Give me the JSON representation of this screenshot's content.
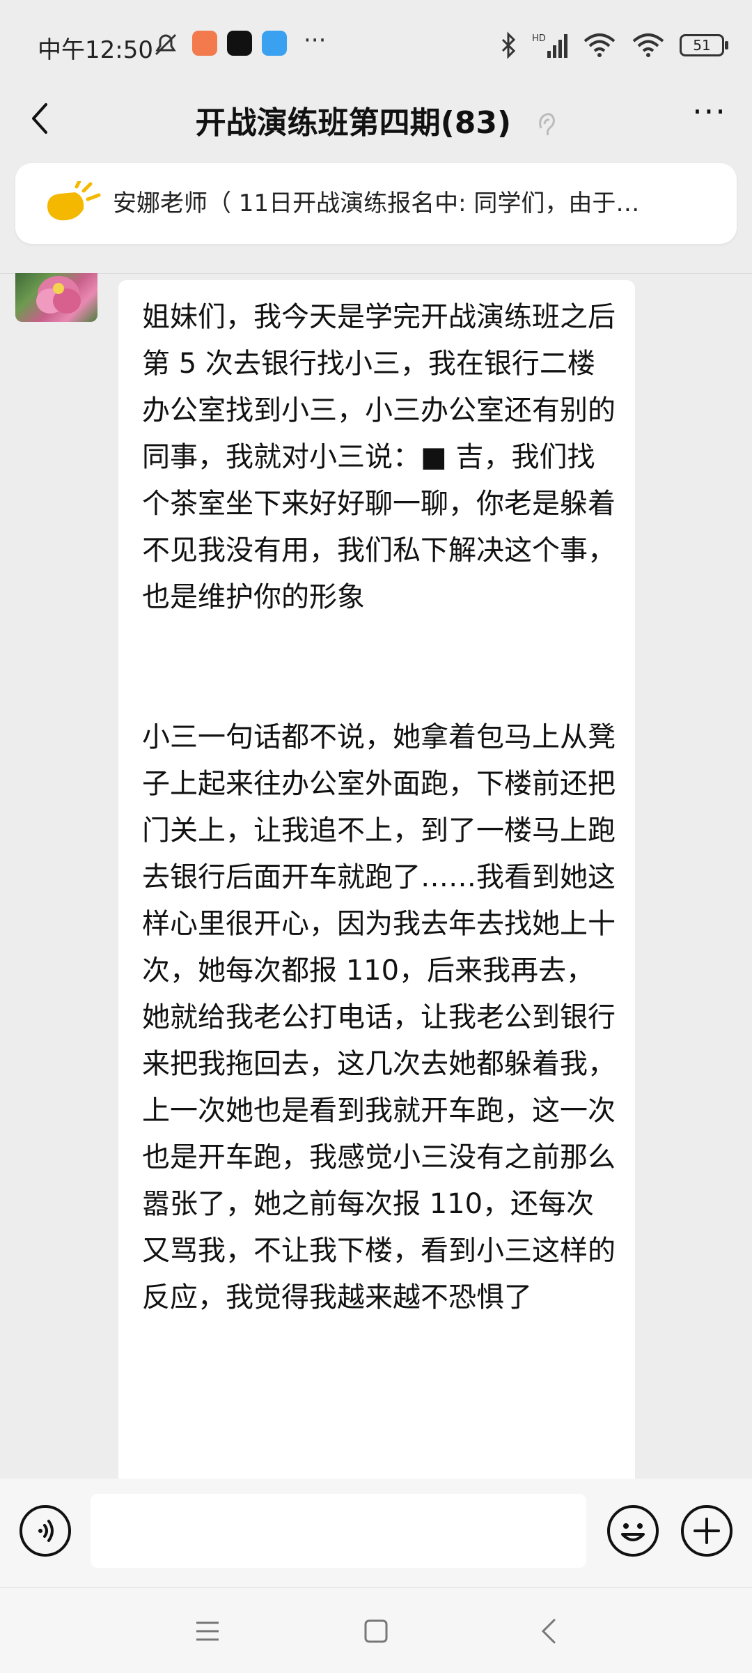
{
  "status_bar": {
    "time": "中午12:50",
    "battery": "51",
    "app_icon_colors": [
      "#f27a4d",
      "#111111",
      "#3aa0f0"
    ],
    "overflow": "···"
  },
  "header": {
    "title": "开战演练班第四期(83)",
    "more": "···"
  },
  "notice": {
    "text": "安娜老师（ 11日开战演练报名中: 同学们，由于…",
    "icon": "megaphone-icon",
    "icon_color": "#f5b800"
  },
  "message": {
    "sender_avatar": "lotus-avatar",
    "text": "姐妹们，我今天是学完开战演练班之后第 5 次去银行找小三，我在银行二楼办公室找到小三，小三办公室还有别的同事，我就对小三说：■ 吉，我们找个茶室坐下来好好聊一聊，你老是躲着不见我没有用，我们私下解决这个事，也是维护你的形象\n\n\n小三一句话都不说，她拿着包马上从凳子上起来往办公室外面跑，下楼前还把门关上，让我追不上，到了一楼马上跑去银行后面开车就跑了……我看到她这样心里很开心，因为我去年去找她上十次，她每次都报 110，后来我再去，她就给我老公打电话，让我老公到银行来把我拖回去，这几次去她都躲着我，上一次她也是看到我就开车跑，这一次也是开车跑，我感觉小三没有之前那么嚣张了，她之前每次报 110，还每次又骂我，不让我下楼，看到小三这样的反应，我觉得我越来越不恐惧了"
  },
  "input_bar": {
    "voice": "voice-icon",
    "emoji": "emoji-icon",
    "plus": "plus-icon"
  },
  "nav": {
    "menu": "menu-icon",
    "home": "home-icon",
    "back": "back-icon"
  }
}
